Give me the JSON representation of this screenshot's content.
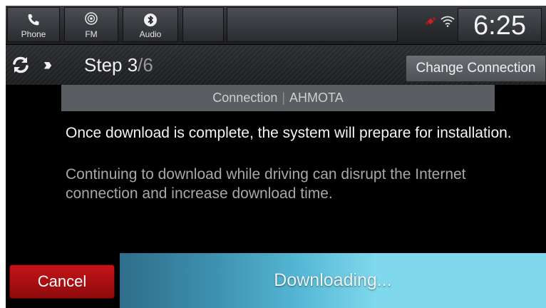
{
  "topbar": {
    "tabs": [
      {
        "label": "Phone",
        "icon": "phone-icon"
      },
      {
        "label": "FM",
        "icon": "radio-icon"
      },
      {
        "label": "Audio",
        "icon": "bluetooth-icon"
      }
    ],
    "status_icons": [
      "satellite-icon",
      "wifi-icon"
    ],
    "clock": "6:25"
  },
  "stepbar": {
    "step_label": "Step 3",
    "step_total": "/6",
    "change_connection_label": "Change Connection"
  },
  "connection": {
    "label": "Connection",
    "separator": "|",
    "name": "AHMOTA"
  },
  "messages": {
    "primary": "Once download is complete, the system will prepare for installation.",
    "secondary": "Continuing to download while driving can disrupt the Internet connection and increase download time."
  },
  "bottombar": {
    "cancel_label": "Cancel",
    "progress_label": "Downloading...",
    "progress_fraction": 0.6
  },
  "colors": {
    "cancel": "#b81114",
    "progress_start": "#2f6e8a",
    "progress_end": "#7fd8ec",
    "status_red": "#d01f1f"
  }
}
